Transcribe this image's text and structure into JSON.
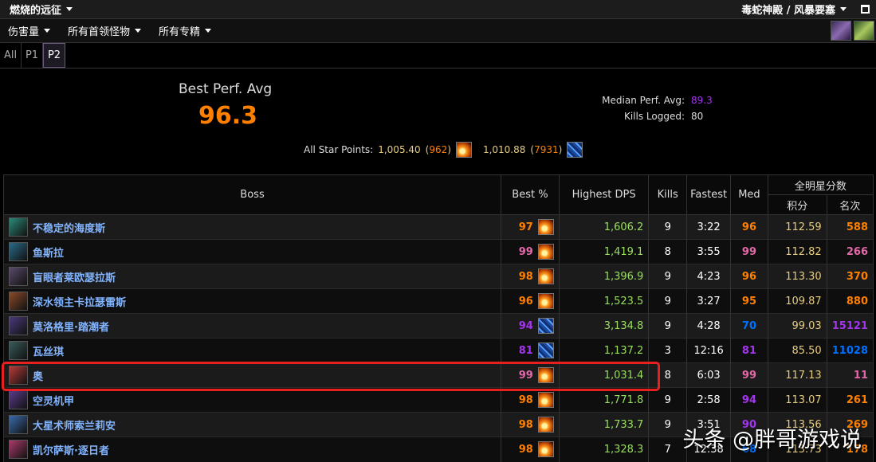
{
  "topbar": {
    "zone": "燃烧的远征",
    "raid": "毒蛇神殿 / 风暴要塞"
  },
  "filters": {
    "metric": "伤害量",
    "boss": "所有首领怪物",
    "spec": "所有专精"
  },
  "tabs": [
    {
      "label": "All"
    },
    {
      "label": "P1"
    },
    {
      "label": "P2"
    }
  ],
  "summary": {
    "best_perf_label": "Best Perf. Avg",
    "best_perf_value": "96.3",
    "median_label": "Median Perf. Avg:",
    "median_value": "89.3",
    "kills_label": "Kills Logged:",
    "kills_value": "80",
    "star_label": "All Star Points:",
    "star1_points": "1,005.40",
    "star1_rank": "962",
    "star2_points": "1,010.88",
    "star2_rank": "7931"
  },
  "table": {
    "headers": {
      "boss": "Boss",
      "best": "Best %",
      "dps": "Highest DPS",
      "kills": "Kills",
      "fastest": "Fastest",
      "med": "Med",
      "allstar": "全明星分数",
      "points": "积分",
      "rank": "名次"
    },
    "rows": [
      {
        "name": "不稳定的海度斯",
        "best": "97",
        "best_color": "#ff8000",
        "spec": "fire",
        "dps": "1,606.2",
        "kills": "9",
        "fastest": "3:22",
        "med": "96",
        "med_color": "#ff8000",
        "points": "112.59",
        "rank": "588",
        "rank_color": "#ff8000",
        "portrait": "#2a8a78"
      },
      {
        "name": "鱼斯拉",
        "best": "99",
        "best_color": "#e268a8",
        "spec": "fire",
        "dps": "1,419.1",
        "kills": "8",
        "fastest": "3:55",
        "med": "99",
        "med_color": "#e268a8",
        "points": "112.82",
        "rank": "266",
        "rank_color": "#e268a8",
        "portrait": "#2a6a88"
      },
      {
        "name": "盲眼者莱欧瑟拉斯",
        "best": "98",
        "best_color": "#ff8000",
        "spec": "fire",
        "dps": "1,396.9",
        "kills": "9",
        "fastest": "4:23",
        "med": "96",
        "med_color": "#ff8000",
        "points": "113.30",
        "rank": "370",
        "rank_color": "#ff8000",
        "portrait": "#5a4a6a"
      },
      {
        "name": "深水领主卡拉瑟雷斯",
        "best": "96",
        "best_color": "#ff8000",
        "spec": "fire",
        "dps": "1,523.5",
        "kills": "9",
        "fastest": "3:27",
        "med": "95",
        "med_color": "#ff8000",
        "points": "109.87",
        "rank": "880",
        "rank_color": "#ff8000",
        "portrait": "#8a4a2a"
      },
      {
        "name": "莫洛格里·踏潮者",
        "best": "94",
        "best_color": "#a335ee",
        "spec": "frost",
        "dps": "3,134.8",
        "kills": "9",
        "fastest": "4:28",
        "med": "70",
        "med_color": "#0070ff",
        "points": "99.03",
        "rank": "15121",
        "rank_color": "#a335ee",
        "portrait": "#4a3a7a"
      },
      {
        "name": "瓦丝琪",
        "best": "81",
        "best_color": "#a335ee",
        "spec": "frost",
        "dps": "1,137.2",
        "kills": "3",
        "fastest": "12:16",
        "med": "81",
        "med_color": "#a335ee",
        "points": "85.50",
        "rank": "11028",
        "rank_color": "#0070ff",
        "portrait": "#3a5a5a"
      },
      {
        "name": "奥",
        "best": "99",
        "best_color": "#e268a8",
        "spec": "fire",
        "dps": "1,031.4",
        "kills": "8",
        "fastest": "6:03",
        "med": "99",
        "med_color": "#e268a8",
        "points": "117.13",
        "rank": "11",
        "rank_color": "#e268a8",
        "portrait": "#b83a3a"
      },
      {
        "name": "空灵机甲",
        "best": "98",
        "best_color": "#ff8000",
        "spec": "fire",
        "dps": "1,771.8",
        "kills": "9",
        "fastest": "2:58",
        "med": "94",
        "med_color": "#a335ee",
        "points": "113.07",
        "rank": "261",
        "rank_color": "#ff8000",
        "portrait": "#5a3a8a"
      },
      {
        "name": "大星术师索兰莉安",
        "best": "98",
        "best_color": "#ff8000",
        "spec": "fire",
        "dps": "1,733.7",
        "kills": "9",
        "fastest": "3:51",
        "med": "90",
        "med_color": "#a335ee",
        "points": "113.56",
        "rank": "269",
        "rank_color": "#ff8000",
        "portrait": "#3a6aaa"
      },
      {
        "name": "凯尔萨斯·逐日者",
        "best": "98",
        "best_color": "#ff8000",
        "spec": "fire",
        "dps": "1,328.3",
        "kills": "7",
        "fastest": "12:38",
        "med": "68",
        "med_color": "#0070ff",
        "points": "113.73",
        "rank": "178",
        "rank_color": "#ff8000",
        "portrait": "#aa3a6a"
      }
    ]
  },
  "watermark": "头条 @胖哥游戏说"
}
